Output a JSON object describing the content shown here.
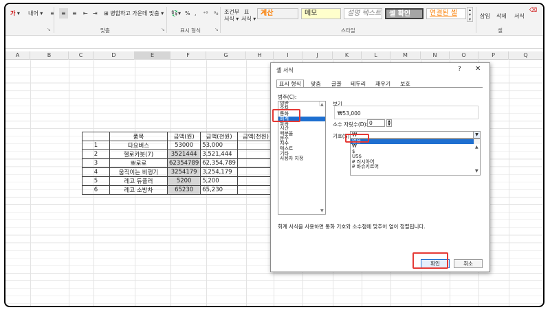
{
  "ribbon": {
    "items": [
      "가",
      "내어",
      "병합하고 가운데 맞춤",
      "%",
      ",",
      "조건부",
      "서식",
      "표",
      "서식",
      "삽입",
      "삭제",
      "서식"
    ],
    "styles": {
      "calc": "계산",
      "memo": "메모",
      "desc_text": "설명 텍스트",
      "check_cell": "셀 확인",
      "linked_cell": "연결된 셀"
    },
    "groups": {
      "align": "맞춤",
      "number": "표시 형식",
      "style": "스타일",
      "cells": "셀"
    }
  },
  "columns": [
    "A",
    "B",
    "C",
    "D",
    "E",
    "F",
    "G",
    "H",
    "I",
    "J",
    "K",
    "L",
    "M",
    "N",
    "O",
    "P",
    "Q"
  ],
  "table": {
    "headers": [
      "",
      "품목",
      "금액(원)",
      "금액(천원)",
      "금액(천원)"
    ],
    "rows": [
      [
        "1",
        "타요버스",
        "53000",
        "53,000",
        ""
      ],
      [
        "2",
        "헬로카봇(7)",
        "3521444",
        "3,521,444",
        ""
      ],
      [
        "3",
        "뽀로로",
        "62354789",
        "62,354,789",
        ""
      ],
      [
        "4",
        "움직이는 비행기",
        "3254179",
        "3,254,179",
        ""
      ],
      [
        "5",
        "레고 듀플러",
        "5200",
        "5,200",
        ""
      ],
      [
        "6",
        "레고 소방차",
        "65230",
        "65,230",
        ""
      ]
    ]
  },
  "dialog": {
    "title": "셀 서식",
    "help": "?",
    "close": "✕",
    "tabs": [
      "표시 형식",
      "맞춤",
      "글꼴",
      "테두리",
      "채우기",
      "보호"
    ],
    "category_label": "범주(C):",
    "categories": [
      "일반",
      "숫자",
      "통화",
      "회계",
      "날짜",
      "시간",
      "백분율",
      "분수",
      "지수",
      "텍스트",
      "기타",
      "사용자 지정"
    ],
    "selected_category": 3,
    "sample_label": "보기",
    "sample_value": "₩53,000",
    "decimal_label": "소수 자릿수(D):",
    "decimal_value": "0",
    "symbol_label": "기호(S):",
    "symbol_value": "₩",
    "symbol_options": [
      "없음",
      "₩",
      "$",
      "US$",
      "₽ 러시아어",
      "₽ 바슈키르어"
    ],
    "selected_symbol": 0,
    "description": "회계 서식을 사용하면 통화 기호와 소수점에 맞추어 열이 정렬됩니다.",
    "ok": "확인",
    "cancel": "취소"
  },
  "colors": {
    "accent": "#1e6fd0",
    "highlight": "#e53935",
    "check_cell_bg": "#a5a5a5",
    "calc_text": "#fa7d00",
    "linked_text": "#fa7d00"
  }
}
